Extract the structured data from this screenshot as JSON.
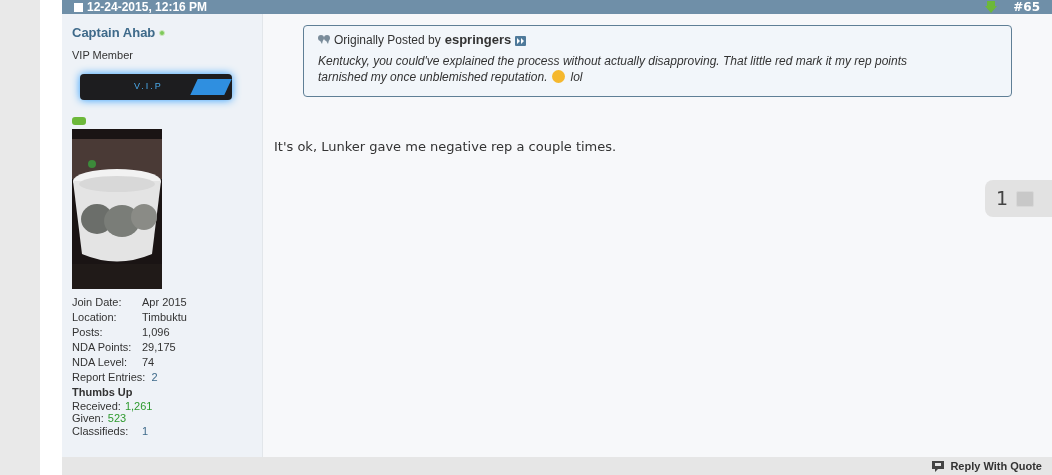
{
  "post_header": {
    "date": "12-24-2015, 12:16 PM",
    "post_number": "#65"
  },
  "user": {
    "name": "Captain Ahab",
    "online": true,
    "title": "VIP Member",
    "badge": "V.I.P",
    "details": [
      {
        "label": "Join Date:",
        "value": "Apr 2015",
        "kind": "plain"
      },
      {
        "label": "Location:",
        "value": "Timbuktu",
        "kind": "plain"
      },
      {
        "label": "Posts:",
        "value": "1,096",
        "kind": "plain"
      },
      {
        "label": "NDA Points:",
        "value": "29,175",
        "kind": "plain"
      },
      {
        "label": "NDA Level:",
        "value": "74",
        "kind": "plain"
      },
      {
        "label": "Report Entries:",
        "value": "2",
        "kind": "link"
      }
    ],
    "thumbs_heading": "Thumbs Up",
    "thumbs": [
      {
        "label": "Received:",
        "value": "1,261"
      },
      {
        "label": "Given:",
        "value": "523"
      }
    ],
    "classifieds": {
      "label": "Classifieds:",
      "value": "1"
    }
  },
  "quote": {
    "prefix": "Originally Posted by",
    "author": "espringers",
    "lines": [
      "Kentucky, you could've explained the process without actually disapproving. That little red mark it my rep points",
      "tarnished my once unblemished reputation."
    ],
    "suffix": "lol"
  },
  "message": "It's ok, Lunker gave me negative rep a couple times.",
  "reputation": {
    "count": "1"
  },
  "footer": {
    "reply_with_quote": "Reply With Quote"
  }
}
